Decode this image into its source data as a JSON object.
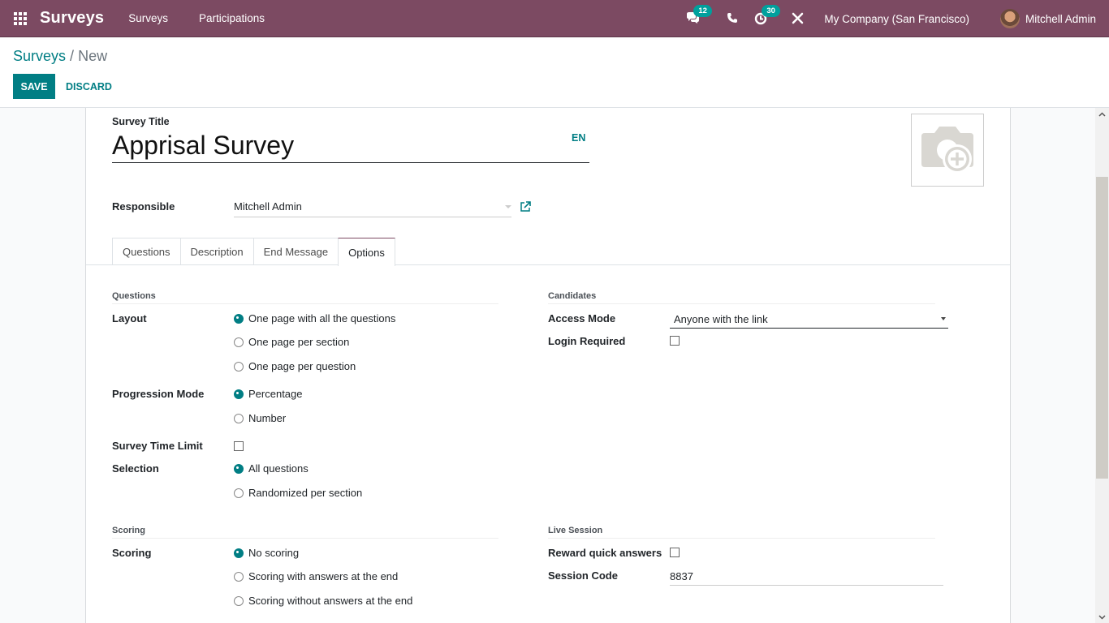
{
  "navbar": {
    "app_name": "Surveys",
    "menu": [
      "Surveys",
      "Participations"
    ],
    "messages_count": "12",
    "activities_count": "30",
    "company": "My Company (San Francisco)",
    "user": "Mitchell Admin"
  },
  "control_panel": {
    "breadcrumb_parent": "Surveys",
    "breadcrumb_separator": "/",
    "breadcrumb_current": "New",
    "save_label": "SAVE",
    "discard_label": "DISCARD"
  },
  "form": {
    "title_label": "Survey Title",
    "title_value": "Apprisal Survey",
    "lang": "EN",
    "responsible_label": "Responsible",
    "responsible_value": "Mitchell Admin",
    "tabs": [
      "Questions",
      "Description",
      "End Message",
      "Options"
    ],
    "active_tab": "Options"
  },
  "options": {
    "questions_group": {
      "title": "Questions",
      "layout_label": "Layout",
      "layout_options": [
        "One page with all the questions",
        "One page per section",
        "One page per question"
      ],
      "layout_selected": 0,
      "progression_label": "Progression Mode",
      "progression_options": [
        "Percentage",
        "Number"
      ],
      "progression_selected": 0,
      "time_limit_label": "Survey Time Limit",
      "time_limit_checked": false,
      "selection_label": "Selection",
      "selection_options": [
        "All questions",
        "Randomized per section"
      ],
      "selection_selected": 0
    },
    "candidates_group": {
      "title": "Candidates",
      "access_mode_label": "Access Mode",
      "access_mode_value": "Anyone with the link",
      "login_required_label": "Login Required",
      "login_required_checked": false
    },
    "scoring_group": {
      "title": "Scoring",
      "scoring_label": "Scoring",
      "scoring_options": [
        "No scoring",
        "Scoring with answers at the end",
        "Scoring without answers at the end"
      ],
      "scoring_selected": 0
    },
    "live_session_group": {
      "title": "Live Session",
      "reward_label": "Reward quick answers",
      "reward_checked": false,
      "session_code_label": "Session Code",
      "session_code_value": "8837"
    }
  },
  "colors": {
    "navbar": "#7c4a62",
    "primary": "#017e84",
    "badge": "#00a09d"
  }
}
